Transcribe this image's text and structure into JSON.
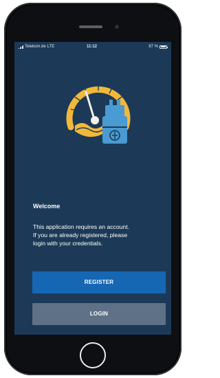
{
  "status_bar": {
    "carrier": "Telekom.de",
    "network": "LTE",
    "time": "11:12",
    "battery": "87 %"
  },
  "logo": {
    "icon": "gauge-and-plug-icon",
    "colors": {
      "gauge": "#f3b83a",
      "plug": "#4a9bd1"
    }
  },
  "welcome": {
    "title": "Welcome",
    "line1": "This application requires an account.",
    "line2": "If you are already registered, please",
    "line3": "login with your credentials."
  },
  "buttons": {
    "register_label": "REGISTER",
    "login_label": "LOGIN"
  },
  "colors": {
    "background": "#1c3a57",
    "register": "#1667b3",
    "login": "#5e7186"
  }
}
